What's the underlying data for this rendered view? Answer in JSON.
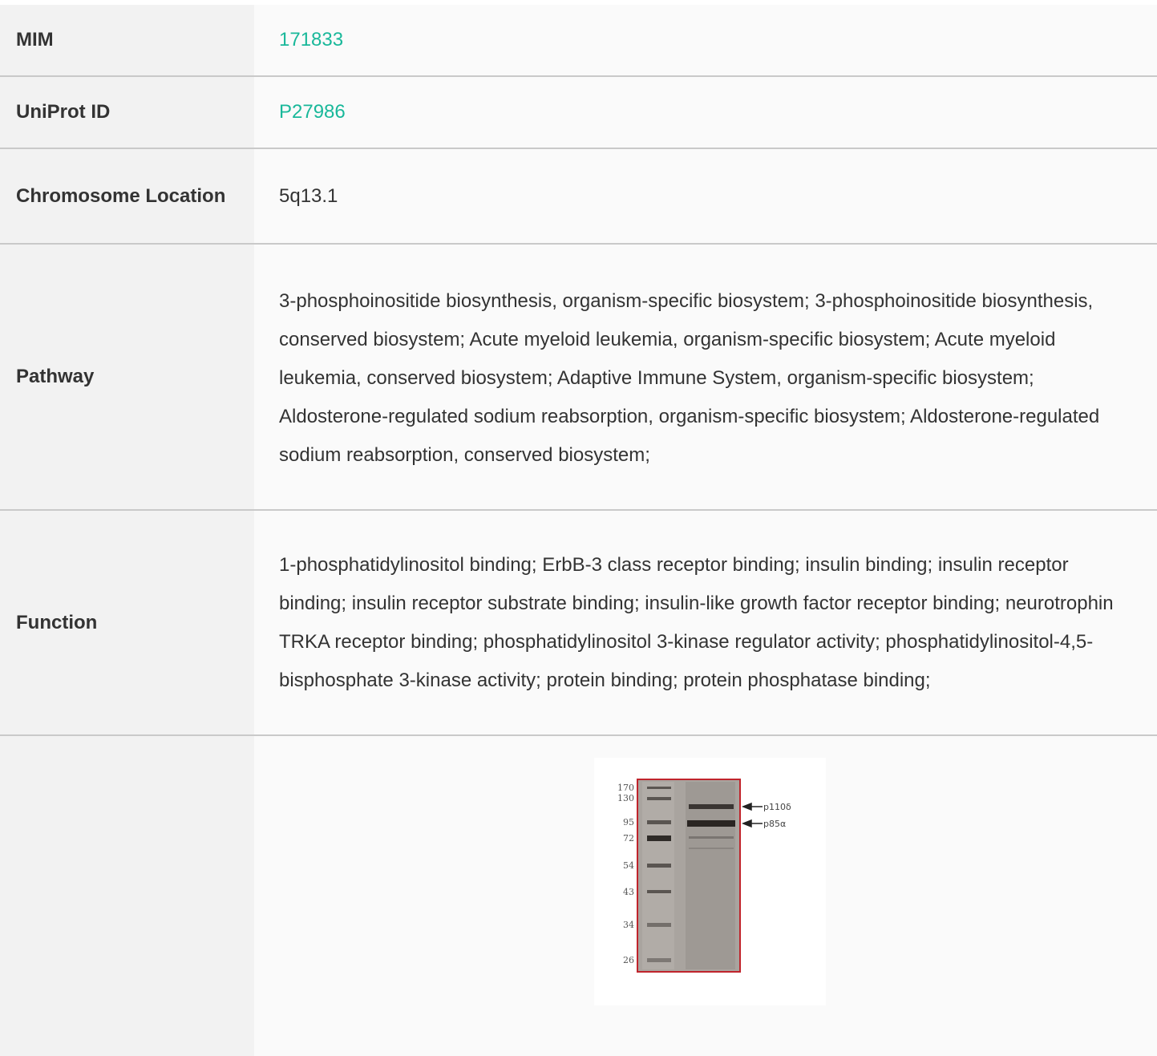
{
  "rows": [
    {
      "label": "MIM",
      "value": "171833"
    },
    {
      "label": "UniProt ID",
      "value": "P27986"
    },
    {
      "label": "Chromosome Location",
      "value": "5q13.1"
    },
    {
      "label": "Pathway",
      "value": "3-phosphoinositide biosynthesis, organism-specific biosystem; 3-phosphoinositide biosynthesis, conserved biosystem; Acute myeloid leukemia, organism-specific biosystem; Acute myeloid leukemia, conserved biosystem; Adaptive Immune System, organism-specific biosystem; Aldosterone-regulated sodium reabsorption, organism-specific biosystem; Aldosterone-regulated sodium reabsorption, conserved biosystem;"
    },
    {
      "label": "Function",
      "value": "1-phosphatidylinositol binding; ErbB-3 class receptor binding; insulin binding; insulin receptor binding; insulin receptor substrate binding; insulin-like growth factor receptor binding; neurotrophin TRKA receptor binding; phosphatidylinositol 3-kinase regulator activity; phosphatidylinositol-4,5-bisphosphate 3-kinase activity; protein binding; protein phosphatase binding;"
    },
    {
      "label": ""
    }
  ],
  "gel": {
    "markers": [
      "170",
      "130",
      "95",
      "72",
      "54",
      "43",
      "34",
      "26"
    ],
    "annotations": [
      "p110δ",
      "p85α"
    ]
  },
  "colors": {
    "link": "#19b89a",
    "label_bg": "#f2f2f2",
    "value_bg": "#fafafa",
    "divider": "#c9c9c9",
    "gel_border": "#c0242c"
  }
}
